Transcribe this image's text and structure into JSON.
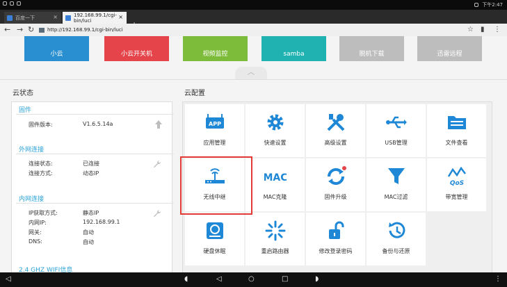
{
  "statusbar": {
    "time": "下午2:47"
  },
  "browser": {
    "tabs": [
      {
        "label": "百度一下"
      },
      {
        "label": "192.168.99.1/cgi-bin/luci"
      }
    ],
    "url": "http://192.168.99.1/cgi-bin/luci"
  },
  "apps": [
    {
      "label": "小云",
      "color": "#2a8fd0"
    },
    {
      "label": "小云开关机",
      "color": "#e5444a"
    },
    {
      "label": "视频监控",
      "color": "#7dbb3a"
    },
    {
      "label": "samba",
      "color": "#1fb2b1"
    },
    {
      "label": "脱机下载",
      "color": "#bdbdbd"
    },
    {
      "label": "迅雷远程",
      "color": "#bdbdbd"
    }
  ],
  "left": {
    "title": "云状态",
    "firmware": {
      "title": "固件",
      "version_label": "固件版本:",
      "version_value": "V1.6.5.14a"
    },
    "wan": {
      "title": "外网连接",
      "status_label": "连接状态:",
      "status_value": "已连接",
      "mode_label": "连接方式:",
      "mode_value": "动态IP"
    },
    "lan": {
      "title": "内网连接",
      "ipmode_label": "IP获取方式:",
      "ipmode_value": "静态IP",
      "ip_label": "内网IP:",
      "ip_value": "192.168.99.1",
      "gw_label": "网关:",
      "gw_value": "自动",
      "dns_label": "DNS:",
      "dns_value": "自动"
    },
    "wifi": {
      "title": "2.4 GHZ WIFI信息"
    }
  },
  "right": {
    "title": "云配置",
    "icon_color": "#1f88d6",
    "tiles": [
      {
        "label": "应用管理",
        "icon": "app-icon"
      },
      {
        "label": "快速设置",
        "icon": "gear-icon"
      },
      {
        "label": "高级设置",
        "icon": "tools-icon"
      },
      {
        "label": "USB管理",
        "icon": "usb-icon"
      },
      {
        "label": "文件查看",
        "icon": "folder-icon"
      },
      {
        "label": "无线中继",
        "icon": "router-icon"
      },
      {
        "label": "MAC克隆",
        "icon": "mac-icon"
      },
      {
        "label": "固件升级",
        "icon": "refresh-icon"
      },
      {
        "label": "MAC过滤",
        "icon": "filter-icon"
      },
      {
        "label": "带宽管理",
        "icon": "qos-icon"
      },
      {
        "label": "硬盘休眠",
        "icon": "harddisk-icon"
      },
      {
        "label": "重启路由器",
        "icon": "restart-icon"
      },
      {
        "label": "修改登录密码",
        "icon": "unlock-icon"
      },
      {
        "label": "备份与还原",
        "icon": "backup-icon"
      }
    ]
  }
}
